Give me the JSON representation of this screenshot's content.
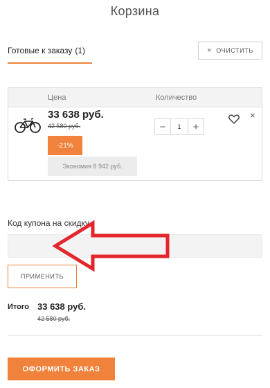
{
  "page": {
    "title": "Корзина"
  },
  "tabs": [
    {
      "label": "Готовые к заказу",
      "count": "(1)"
    }
  ],
  "clear_button": {
    "icon": "×",
    "label": "ОЧИСТИТЬ"
  },
  "cart": {
    "columns": {
      "price": "Цена",
      "quantity": "Количество"
    },
    "items": [
      {
        "image": "bicycle-icon",
        "price": "33 638 руб.",
        "old_price": "42 580 руб.",
        "discount": "-21%",
        "savings": "Экономия 8 942 руб.",
        "quantity": "1",
        "minus": "−",
        "plus": "+",
        "remove": "×"
      }
    ]
  },
  "coupon": {
    "label": "Код купона на скидку",
    "value": "",
    "placeholder": "",
    "apply_label": "ПРИМЕНИТЬ"
  },
  "total": {
    "label": "Итого",
    "price": "33 638 руб.",
    "old_price": "42 580 руб."
  },
  "checkout": {
    "label": "ОФОРМИТЬ ЗАКАЗ"
  },
  "colors": {
    "accent": "#f0823b",
    "annotation_arrow": "#e3262d"
  }
}
